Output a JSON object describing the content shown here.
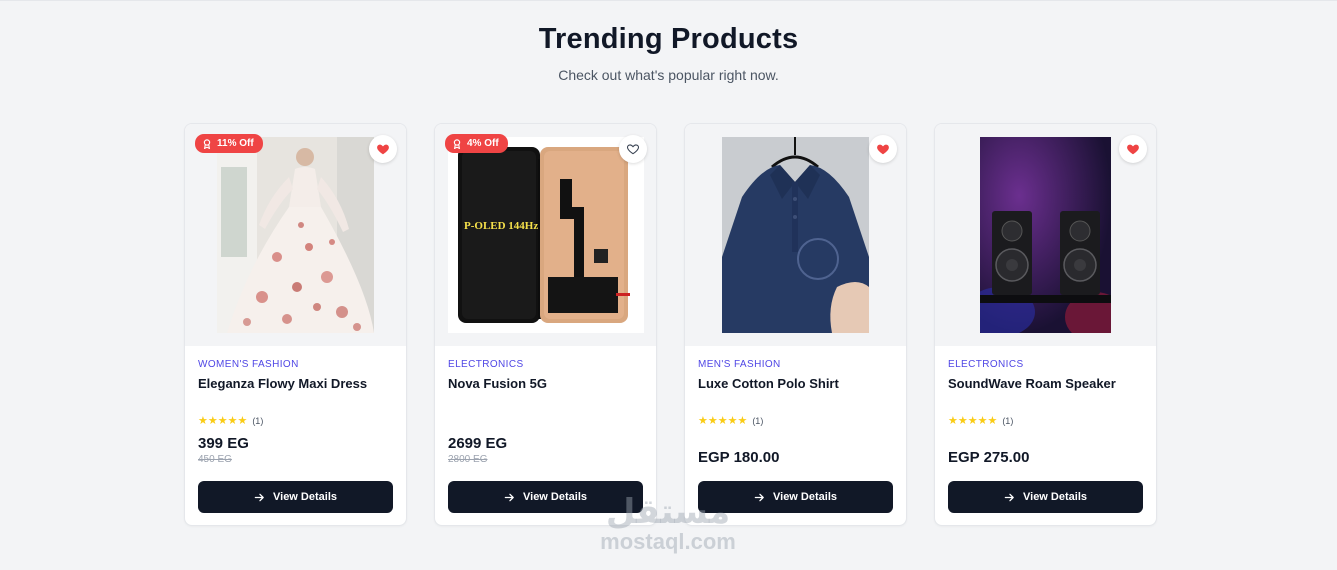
{
  "section": {
    "title": "Trending Products",
    "subtitle": "Check out what's popular right now."
  },
  "colors": {
    "accent": "#4f46e5",
    "button": "#111827",
    "badge": "#ef4444",
    "heart": "#ef4444",
    "star": "#facc15"
  },
  "products": [
    {
      "badge": "11% Off",
      "category": "WOMEN'S FASHION",
      "name": "Eleganza Flowy Maxi Dress",
      "stars": "★★★★★",
      "rating_count": "(1)",
      "price": "399 EG",
      "old_price": "450 EG",
      "button": "View Details",
      "wishlisted": true,
      "image_icon": "floral-dress-image"
    },
    {
      "badge": "4% Off",
      "category": "ELECTRONICS",
      "name": "Nova Fusion 5G",
      "price": "2699 EG",
      "old_price": "2800 EG",
      "button": "View Details",
      "wishlisted": false,
      "image_text": "P-OLED 144Hz",
      "image_icon": "phone-screen-image"
    },
    {
      "category": "MEN'S FASHION",
      "name": "Luxe Cotton Polo Shirt",
      "stars": "★★★★★",
      "rating_count": "(1)",
      "price": "EGP 180.00",
      "button": "View Details",
      "wishlisted": true,
      "image_icon": "polo-shirt-image"
    },
    {
      "category": "ELECTRONICS",
      "name": "SoundWave Roam Speaker",
      "stars": "★★★★★",
      "rating_count": "(1)",
      "price": "EGP 275.00",
      "button": "View Details",
      "wishlisted": true,
      "image_icon": "speakers-image"
    }
  ],
  "watermark": {
    "logo": "مستقل",
    "text": "mostaql.com"
  }
}
